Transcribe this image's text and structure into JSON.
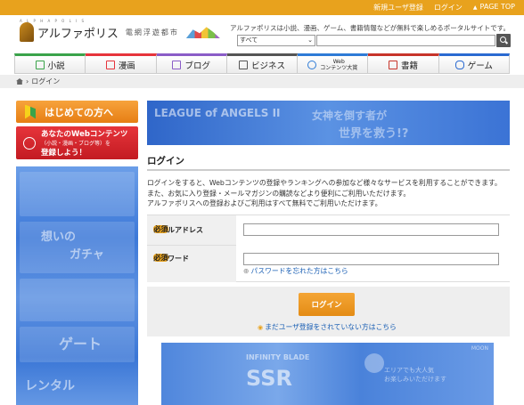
{
  "topbar": {
    "register": "新規ユーザ登録",
    "login": "ログイン",
    "page_top": "PAGE TOP"
  },
  "header": {
    "logo_sub": "A L P H A P O L I S",
    "logo_name": "アルファポリス",
    "logo_tag": "電網浮遊都市",
    "tagline": "アルファポリスは小説、漫画、ゲーム、書籍情報などが無料で楽しめるポータルサイトです。",
    "search_select": "すべて"
  },
  "nav": [
    {
      "label": "小説",
      "color": "#3aa34a"
    },
    {
      "label": "漫画",
      "color": "#e6343b"
    },
    {
      "label": "ブログ",
      "color": "#8a5cc7"
    },
    {
      "label": "ビジネス",
      "color": "#555555"
    },
    {
      "label": "Web",
      "sub": "コンテンツ大賞",
      "color": "#2e7bd6"
    },
    {
      "label": "書籍",
      "color": "#c7342a"
    },
    {
      "label": "ゲーム",
      "color": "#2a6ad1"
    }
  ],
  "breadcrumb": {
    "current": "ログイン"
  },
  "sidebar": {
    "beginner": "はじめての方へ",
    "web_line1": "あなたのWebコンテンツ",
    "web_line2": "（小説・漫画・ブログ等）を",
    "web_line3": "登録しよう！",
    "ad_texts": [
      "想いの",
      "ガチャ",
      "ゲート",
      "レンタル"
    ]
  },
  "banner": {
    "brand": "LEAGUE of ANGELS II",
    "text1": "女神を倒す者が",
    "text2": "世界を救う!?"
  },
  "main": {
    "title": "ログイン",
    "intro1": "ログインをすると、Webコンテンツの登録やランキングへの参加など様々なサービスを利用することができます。",
    "intro2": "また、お気に入り登録・メールマガジンの購読などより便利にご利用いただけます。",
    "intro3": "アルファポリスへの登録およびご利用はすべて無料でご利用いただけます。"
  },
  "form": {
    "email_label": "メールアドレス",
    "password_label": "パスワード",
    "required": "必須",
    "forgot": "パスワードを忘れた方はこちら",
    "submit": "ログイン",
    "register": "まだユーザ登録をされていない方はこちら"
  },
  "bottom_ad": {
    "small": "INFINITY BLADE",
    "big": "SSR",
    "corner": "MOON",
    "line1": "エリアでも大人気",
    "line2": "お楽しみいただけます"
  }
}
